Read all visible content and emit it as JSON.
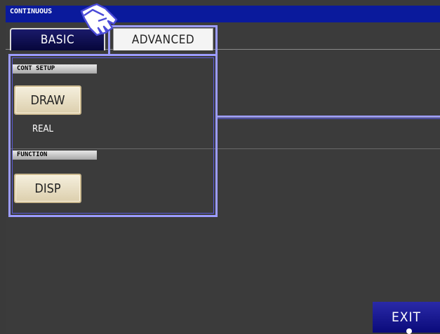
{
  "header": {
    "title": "CONTINUOUS"
  },
  "tabs": [
    {
      "label": "BASIC",
      "active": true
    },
    {
      "label": "ADVANCED",
      "active": false
    }
  ],
  "sections": {
    "cont_setup": {
      "label": "CONT SETUP",
      "button_label": "DRAW",
      "value": "REAL"
    },
    "function": {
      "label": "FUNCTION",
      "button_label": "DISP"
    }
  },
  "footer": {
    "exit_label": "EXIT"
  },
  "colors": {
    "header_bg": "#0a1a9c",
    "screen_bg": "#3b3b3b",
    "highlight": "#9c9cff",
    "button_face": "#f0e8d2",
    "exit_bg": "#1a1a9a"
  },
  "icons": {
    "pointer": "pointing-hand-icon"
  }
}
